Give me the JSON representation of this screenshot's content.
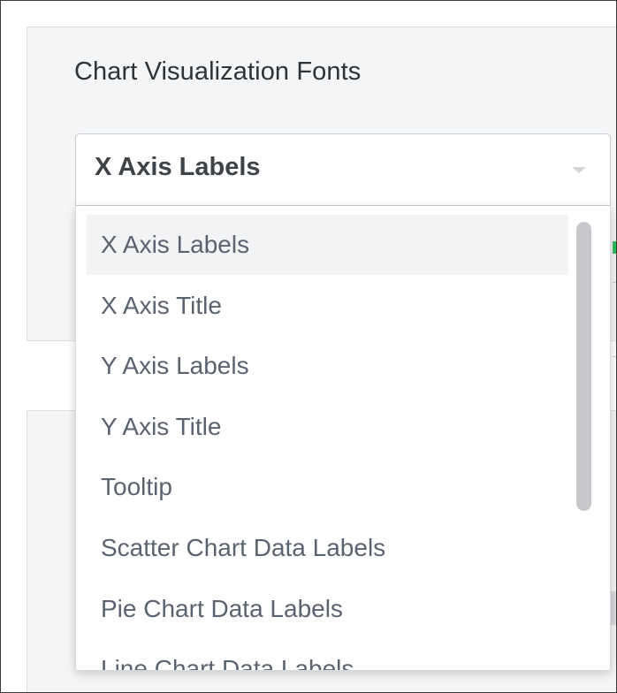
{
  "section": {
    "title": "Chart Visualization Fonts"
  },
  "select": {
    "value": "X Axis Labels",
    "caret_icon": "chevron-down-icon",
    "options": [
      {
        "label": "X Axis Labels",
        "selected": true
      },
      {
        "label": "X Axis Title",
        "selected": false
      },
      {
        "label": "Y Axis Labels",
        "selected": false
      },
      {
        "label": "Y Axis Title",
        "selected": false
      },
      {
        "label": "Tooltip",
        "selected": false
      },
      {
        "label": "Scatter Chart Data Labels",
        "selected": false
      },
      {
        "label": "Pie Chart Data Labels",
        "selected": false
      },
      {
        "label": "Line Chart Data Labels",
        "selected": false
      }
    ]
  },
  "colors": {
    "panel_background": "#f4f5f6",
    "option_text": "#5c6370",
    "selected_option_background": "#f2f3f5",
    "accent_green": "#2ebd59"
  }
}
